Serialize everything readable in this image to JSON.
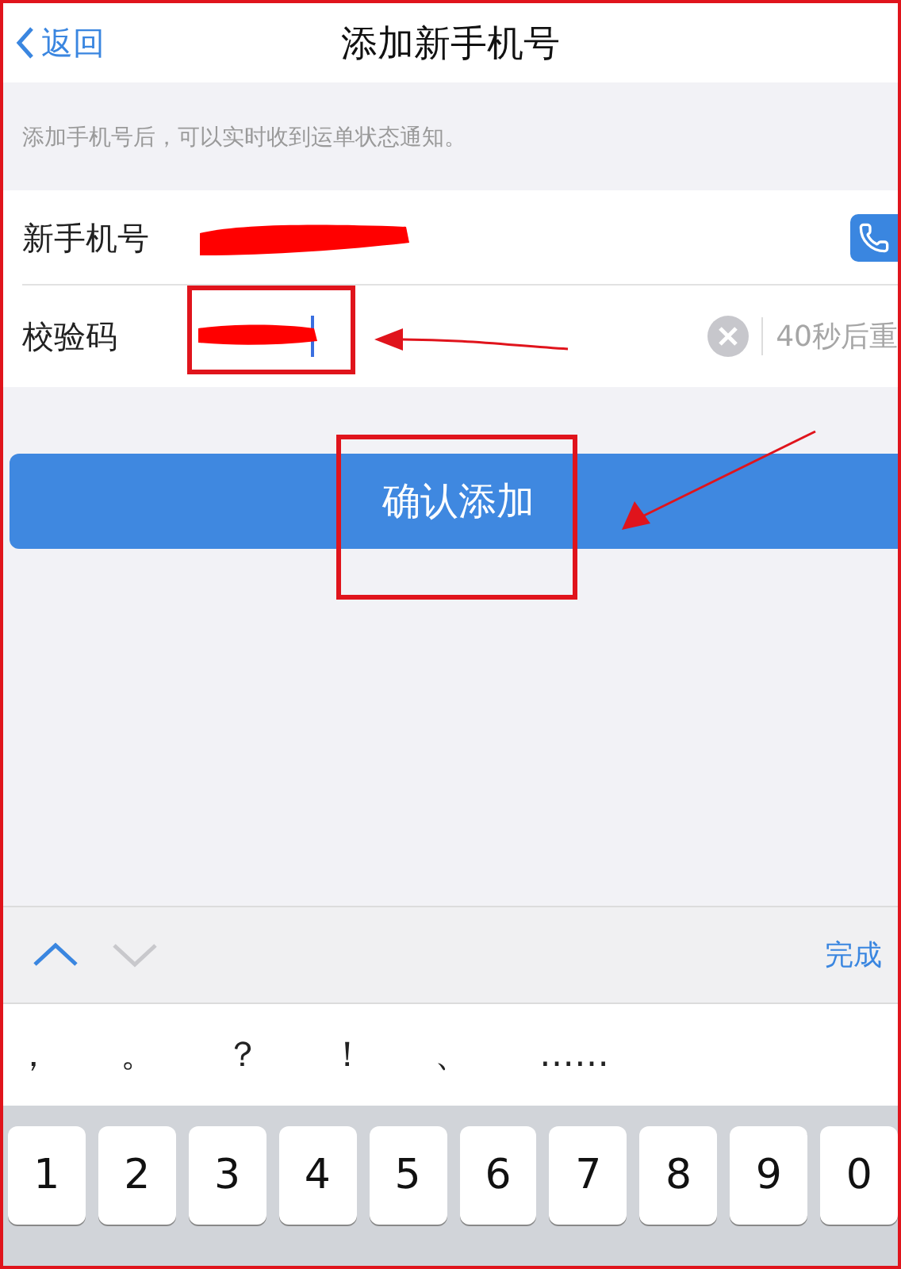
{
  "nav": {
    "back": "返回",
    "title": "添加新手机号"
  },
  "hint": "添加手机号后，可以实时收到运单状态通知。",
  "fields": [
    {
      "kind": "phone",
      "label": "新手机号",
      "redacted": true,
      "highlighted": false
    },
    {
      "kind": "code",
      "label": "校验码",
      "redacted": true,
      "highlighted": true,
      "resend": "40秒后重"
    }
  ],
  "button": {
    "label": "确认添加",
    "highlighted": true
  },
  "toolbar": {
    "prev_enabled": true,
    "next_enabled": false,
    "done": "完成"
  },
  "suggestions": [
    "，",
    "。",
    "？",
    "！",
    "、",
    "……"
  ],
  "keys": [
    "1",
    "2",
    "3",
    "4",
    "5",
    "6",
    "7",
    "8",
    "9",
    "0"
  ]
}
